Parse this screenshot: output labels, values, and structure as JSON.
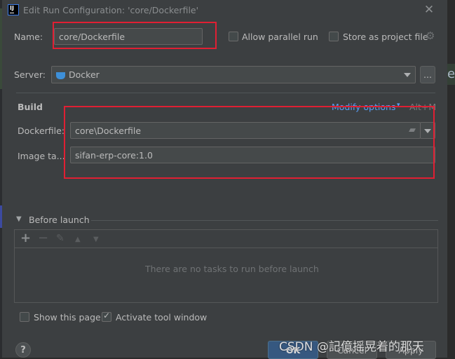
{
  "window": {
    "title": "Edit Run Configuration: 'core/Dockerfile'",
    "app_icon": "IJ"
  },
  "header": {
    "name_label": "Name:",
    "name_value": "core/Dockerfile",
    "allow_parallel_label": "Allow parallel run",
    "allow_parallel_checked": false,
    "store_project_label": "Store as project file",
    "store_project_checked": false
  },
  "server": {
    "label": "Server:",
    "value": "Docker",
    "more_button": "..."
  },
  "build": {
    "section_label": "Build",
    "modify_options": "Modify options",
    "modify_shortcut": "Alt+M",
    "dockerfile_label": "Dockerfile:",
    "dockerfile_value": "core\\Dockerfile",
    "image_tag_label": "Image ta...",
    "image_tag_value": "sifan-erp-core:1.0"
  },
  "before_launch": {
    "label": "Before launch",
    "empty_text": "There are no tasks to run before launch",
    "toolbar": [
      "add-icon",
      "remove-icon",
      "edit-icon",
      "move-up-icon",
      "move-down-icon"
    ]
  },
  "footer": {
    "show_page_label": "Show this page",
    "show_page_checked": false,
    "activate_tool_label": "Activate tool window",
    "activate_tool_checked": true,
    "help": "?",
    "ok": "OK",
    "cancel": "Cancel",
    "apply": "Apply"
  },
  "watermark": "CSDN @記億摇晃着的那天",
  "background_text": "es",
  "colors": {
    "dialog_bg": "#3c3f41",
    "accent_link": "#589df6",
    "highlight_red": "#e01f33",
    "primary_button": "#365880"
  }
}
